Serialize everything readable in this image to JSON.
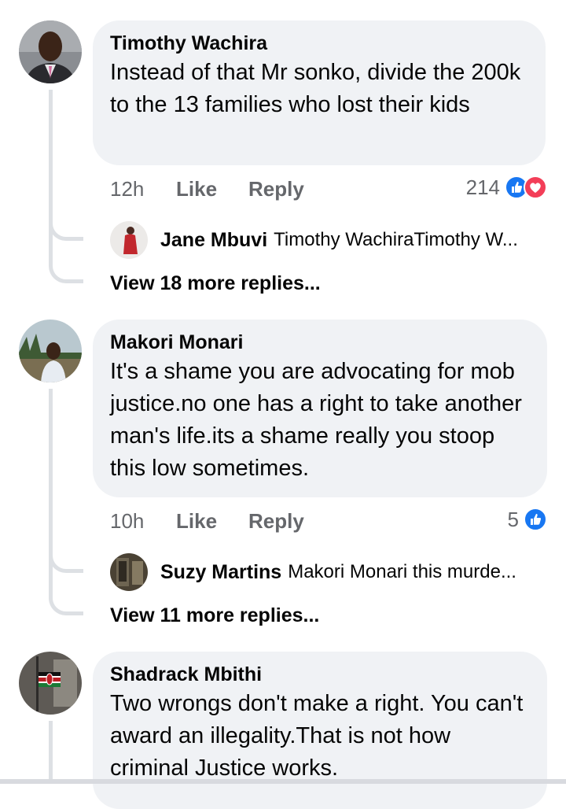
{
  "comments": [
    {
      "author": "Timothy Wachira",
      "text": "Instead of that Mr sonko, divide the 200k to the 13 families who lost their kids",
      "time": "12h",
      "like_label": "Like",
      "reply_label": "Reply",
      "reaction_count": "214",
      "reactions": [
        "like-icon",
        "love-icon"
      ],
      "reply_preview": {
        "author": "Jane Mbuvi",
        "text": "Timothy WachiraTimothy W..."
      },
      "view_more": "View 18 more replies..."
    },
    {
      "author": "Makori Monari",
      "text": "It's a shame you are advocating for mob justice.no one has a right to take another man's life.its a shame really you stoop this low sometimes.",
      "time": "10h",
      "like_label": "Like",
      "reply_label": "Reply",
      "reaction_count": "5",
      "reactions": [
        "like-icon"
      ],
      "reply_preview": {
        "author": "Suzy Martins",
        "text": "Makori Monari this murde..."
      },
      "view_more": "View 11 more replies..."
    },
    {
      "author": "Shadrack Mbithi",
      "text": "Two wrongs don't make a right. You can't award an illegality.That is not how criminal Justice works."
    }
  ],
  "colors": {
    "like_blue": "#1877f2",
    "love_red": "#f33e58",
    "bubble_bg": "#f0f2f5",
    "meta_gray": "#65676b"
  }
}
